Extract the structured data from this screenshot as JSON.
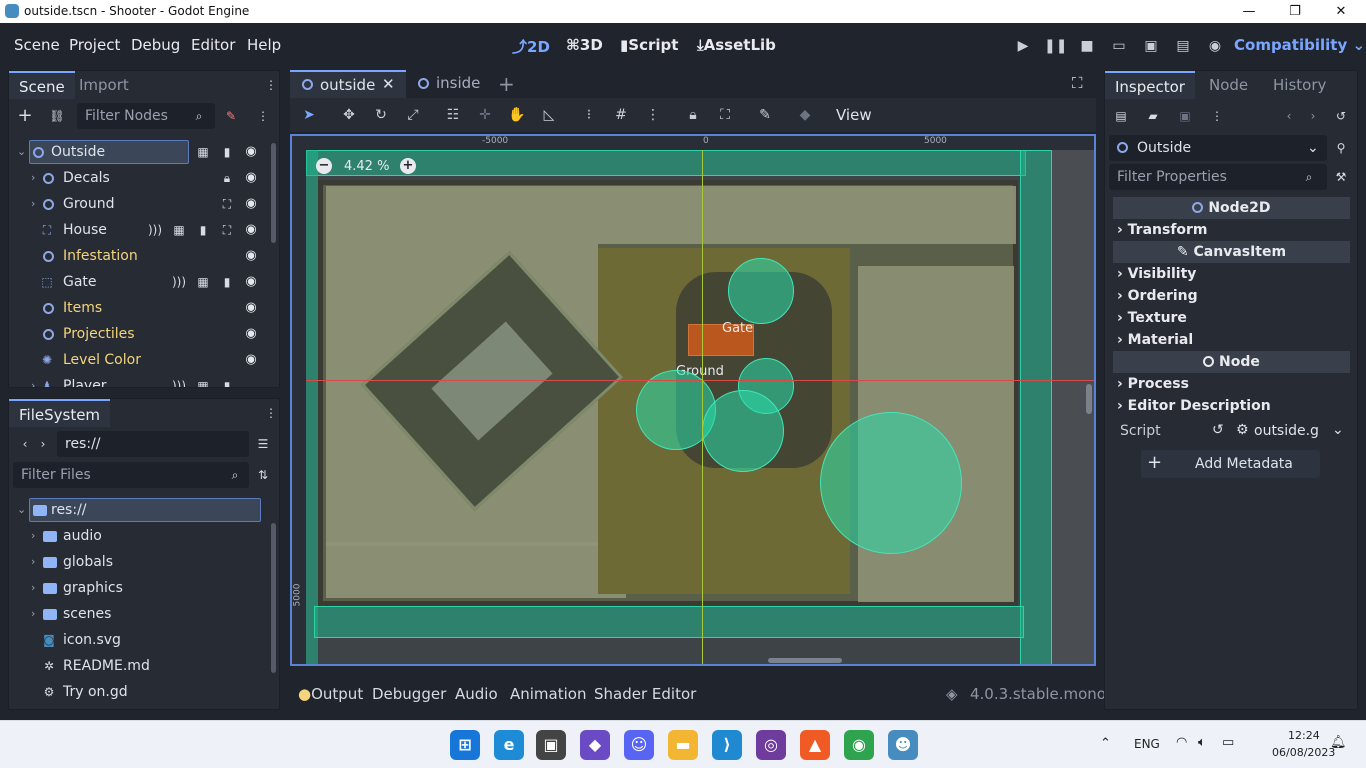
{
  "window": {
    "title": "outside.tscn - Shooter - Godot Engine",
    "minimize": "—",
    "maximize": "❐",
    "close": "✕"
  },
  "menu": [
    "Scene",
    "Project",
    "Debug",
    "Editor",
    "Help"
  ],
  "workspaces": {
    "w2d": "2D",
    "w3d": "3D",
    "script": "Script",
    "assetlib": "AssetLib"
  },
  "renderer": "Compatibility",
  "scene_dock": {
    "tabs": [
      "Scene",
      "Import"
    ],
    "filter_placeholder": "Filter Nodes",
    "nodes": [
      {
        "name": "Outside",
        "icon": "node2d-icon",
        "color": "normal"
      },
      {
        "name": "Decals",
        "icon": "node2d-icon",
        "color": "normal"
      },
      {
        "name": "Ground",
        "icon": "node2d-icon",
        "color": "normal"
      },
      {
        "name": "House",
        "icon": "house-icon",
        "color": "normal"
      },
      {
        "name": "Infestation",
        "icon": "node2d-icon",
        "color": "yellow"
      },
      {
        "name": "Gate",
        "icon": "area-icon",
        "color": "normal"
      },
      {
        "name": "Items",
        "icon": "node2d-icon",
        "color": "yellow"
      },
      {
        "name": "Projectiles",
        "icon": "node2d-icon",
        "color": "yellow"
      },
      {
        "name": "Level Color",
        "icon": "light-icon",
        "color": "yellow"
      },
      {
        "name": "Player",
        "icon": "player-icon",
        "color": "normal"
      }
    ]
  },
  "filesystem": {
    "title": "FileSystem",
    "path": "res://",
    "filter_placeholder": "Filter Files",
    "items": [
      {
        "name": "res://",
        "type": "folder"
      },
      {
        "name": "audio",
        "type": "folder"
      },
      {
        "name": "globals",
        "type": "folder"
      },
      {
        "name": "graphics",
        "type": "folder"
      },
      {
        "name": "scenes",
        "type": "folder"
      },
      {
        "name": "icon.svg",
        "type": "svg"
      },
      {
        "name": "README.md",
        "type": "md"
      },
      {
        "name": "Try on.gd",
        "type": "gd"
      }
    ]
  },
  "editor_tabs": [
    {
      "label": "outside",
      "active": true
    },
    {
      "label": "inside",
      "active": false
    }
  ],
  "viewport": {
    "zoom": "4.42 %",
    "view_menu": "View",
    "ruler_top": [
      "-5000",
      "0",
      "5000"
    ],
    "ruler_left": [
      "5000"
    ],
    "labels": {
      "gate": "Gate",
      "ground": "Ground"
    }
  },
  "bottom_tabs": [
    "Output",
    "Debugger",
    "Audio",
    "Animation",
    "Shader Editor"
  ],
  "version": "4.0.3.stable.mono",
  "inspector": {
    "tabs": [
      "Inspector",
      "Node",
      "History"
    ],
    "object": "Outside",
    "filter_placeholder": "Filter Properties",
    "sections": [
      {
        "label": "Node2D",
        "kind": "head"
      },
      {
        "label": "Transform",
        "kind": "sub"
      },
      {
        "label": "CanvasItem",
        "kind": "head"
      },
      {
        "label": "Visibility",
        "kind": "sub"
      },
      {
        "label": "Ordering",
        "kind": "sub"
      },
      {
        "label": "Texture",
        "kind": "sub"
      },
      {
        "label": "Material",
        "kind": "sub"
      },
      {
        "label": "Node",
        "kind": "head"
      },
      {
        "label": "Process",
        "kind": "sub"
      },
      {
        "label": "Editor Description",
        "kind": "sub"
      }
    ],
    "script_label": "Script",
    "script_value": "outside.g",
    "add_metadata": "Add Metadata"
  },
  "taskbar": {
    "lang": "ENG",
    "time": "12:24",
    "date": "06/08/2023"
  }
}
